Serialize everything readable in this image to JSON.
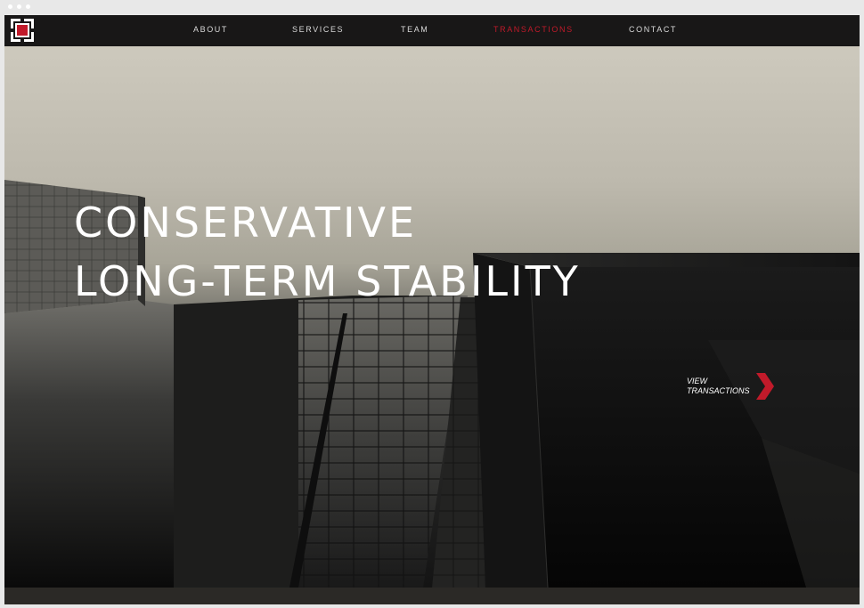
{
  "nav": {
    "items": [
      {
        "label": "ABOUT",
        "active": false
      },
      {
        "label": "SERVICES",
        "active": false
      },
      {
        "label": "TEAM",
        "active": false
      },
      {
        "label": "TRANSACTIONS",
        "active": true
      },
      {
        "label": "CONTACT",
        "active": false
      }
    ]
  },
  "hero": {
    "headline_line1": "CONSERVATIVE",
    "headline_line2": "LONG-TERM STABILITY",
    "cta_line1": "VIEW",
    "cta_line2": "TRANSACTIONS"
  },
  "colors": {
    "accent": "#c11a2a",
    "nav_bg": "#181717",
    "text": "#ffffff"
  },
  "icons": {
    "logo": "square-frame-logo",
    "cta": "chevron-right-icon"
  }
}
